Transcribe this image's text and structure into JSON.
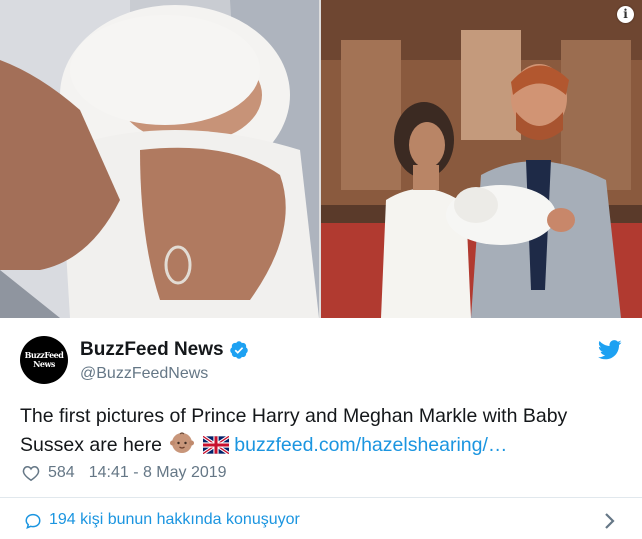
{
  "tweet": {
    "author": {
      "display_name": "BuzzFeed News",
      "handle": "@BuzzFeedNews",
      "avatar_line1": "BuzzFeed",
      "avatar_line2": "News",
      "verified": true
    },
    "text": "The first pictures of Prince Harry and Meghan Markle with Baby Sussex are here",
    "emojis": [
      "baby-emoji",
      "uk-flag-emoji"
    ],
    "link_text": "buzzfeed.com/hazelshearing/…",
    "likes": "584",
    "timestamp": "14:41 - 8 May 2019",
    "conversation_text": "194 kişi bunun hakkında konuşuyor"
  },
  "media": {
    "info_icon_label": "i"
  },
  "colors": {
    "link": "#1b95e0",
    "secondary_text": "#657786",
    "primary_text": "#14171a",
    "divider": "#e1e8ed",
    "twitter_blue": "#1da1f2"
  }
}
